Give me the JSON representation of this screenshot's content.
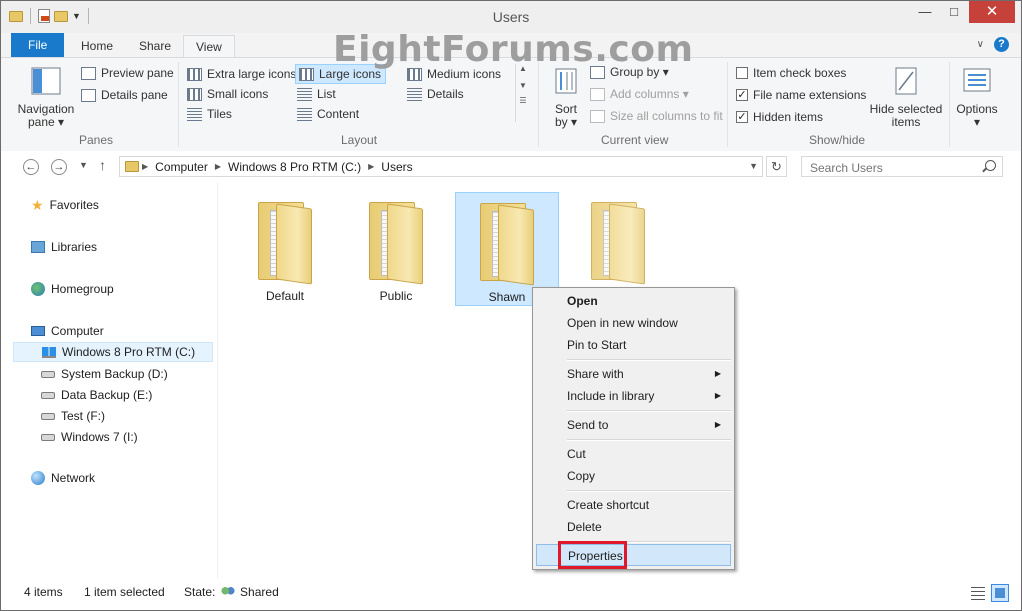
{
  "window": {
    "title": "Users"
  },
  "watermark": "EightForums.com",
  "tabs": {
    "file": "File",
    "home": "Home",
    "share": "Share",
    "view": "View"
  },
  "help_label": "?",
  "ribbon": {
    "panes": {
      "label": "Panes",
      "navigation_pane_l1": "Navigation",
      "navigation_pane_l2": "pane ▾",
      "preview_pane": "Preview pane",
      "details_pane": "Details pane"
    },
    "layout": {
      "label": "Layout",
      "items": [
        "Extra large icons",
        "Large icons",
        "Medium icons",
        "Small icons",
        "List",
        "Details",
        "Tiles",
        "Content"
      ],
      "selected": "Large icons"
    },
    "current_view": {
      "label": "Current view",
      "sort_l1": "Sort",
      "sort_l2": "by ▾",
      "group_by": "Group by ▾",
      "add_columns": "Add columns ▾",
      "size_columns": "Size all columns to fit"
    },
    "show_hide": {
      "label": "Show/hide",
      "item_check_boxes": "Item check boxes",
      "file_name_extensions": "File name extensions",
      "hidden_items": "Hidden items",
      "checks": [
        false,
        true,
        true
      ],
      "hide_selected_l1": "Hide selected",
      "hide_selected_l2": "items"
    },
    "options_l1": "Options",
    "options_l2": "▾"
  },
  "address": {
    "crumbs": [
      "Computer",
      "Windows 8 Pro RTM (C:)",
      "Users"
    ],
    "search_placeholder": "Search Users"
  },
  "nav": {
    "favorites": "Favorites",
    "libraries": "Libraries",
    "homegroup": "Homegroup",
    "computer": "Computer",
    "drives": [
      "Windows 8 Pro RTM (C:)",
      "System Backup (D:)",
      "Data Backup (E:)",
      "Test (F:)",
      "Windows 7 (I:)"
    ],
    "network": "Network"
  },
  "folders": [
    {
      "name": "Default"
    },
    {
      "name": "Public"
    },
    {
      "name": "Shawn",
      "selected": true
    },
    {
      "name": ""
    }
  ],
  "context_menu": {
    "open": "Open",
    "open_new_window": "Open in new window",
    "pin_to_start": "Pin to Start",
    "share_with": "Share with",
    "include_in_library": "Include in library",
    "send_to": "Send to",
    "cut": "Cut",
    "copy": "Copy",
    "create_shortcut": "Create shortcut",
    "delete": "Delete",
    "properties": "Properties"
  },
  "status": {
    "items": "4 items",
    "selected": "1 item selected",
    "state_label": "State:",
    "state_value": "Shared"
  },
  "colors": {
    "accent": "#1979ca",
    "highlight": "#e0182a",
    "selection": "#cde8ff"
  }
}
